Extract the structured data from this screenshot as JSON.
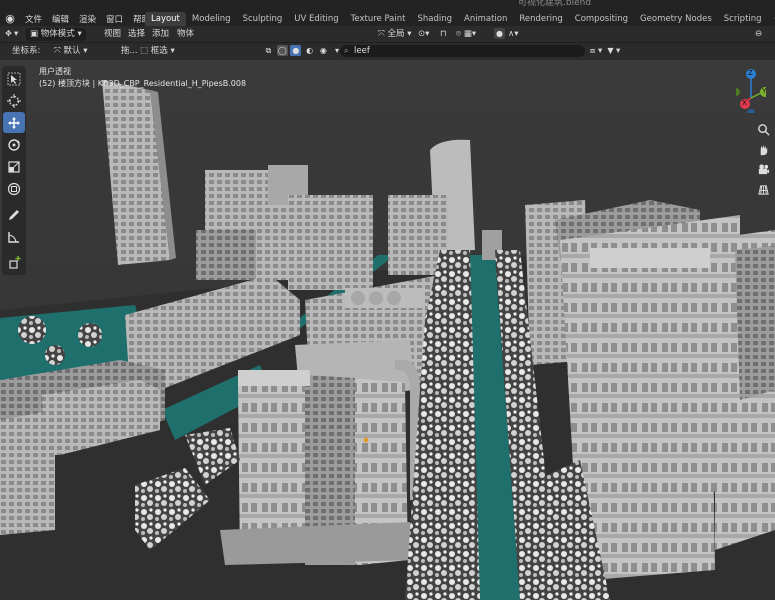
{
  "app": {
    "title": "可视化建筑.blend",
    "menu": [
      "文件",
      "编辑",
      "渲染",
      "窗口",
      "帮助"
    ],
    "workspaces": [
      "Layout",
      "Modeling",
      "Sculpting",
      "UV Editing",
      "Texture Paint",
      "Shading",
      "Animation",
      "Rendering",
      "Compositing",
      "Geometry Nodes",
      "Scripting"
    ],
    "active_workspace": "Layout",
    "add_tab": "+"
  },
  "header": {
    "mode": "物体模式",
    "menus": [
      "视图",
      "选择",
      "添加",
      "物体"
    ],
    "orientation": "全局",
    "coord_label": "坐标系:",
    "coord_value": "默认",
    "drag_label": "拖...",
    "select_mode": "框选"
  },
  "search": {
    "value": "leef"
  },
  "viewport": {
    "view_name": "用户透视",
    "object_info": "(52) 楼顶方块 | KB3D_CBP_Residential_H_PipesB.008"
  },
  "gizmo": {
    "x_label": "X",
    "y_label": "Y",
    "z_label": "Z"
  },
  "colors": {
    "accent": "#4772b3",
    "water": "#1f6f6c",
    "x_axis": "#e23a4c",
    "y_axis": "#7ab22c",
    "z_axis": "#2d7fd3"
  }
}
